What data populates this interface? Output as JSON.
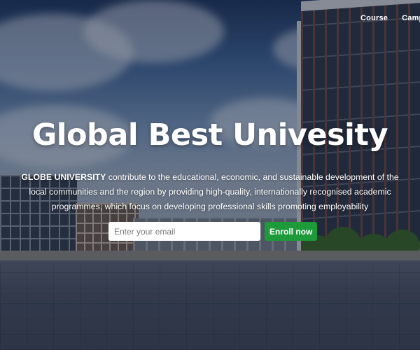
{
  "nav": {
    "items": [
      {
        "label": "Course"
      },
      {
        "label": "Campus"
      }
    ]
  },
  "hero": {
    "title": "Global Best Univesity",
    "brand": "GLOBE UNIVERSITY",
    "description": " contribute to the educational, economic, and sustainable development of the local communities and the region by providing high-quality, internationally recognised academic programmes, which focus on developing professional skills promoting employability"
  },
  "enroll": {
    "email_placeholder": "Enter your email",
    "button_label": "Enroll now"
  },
  "colors": {
    "accent": "#1d9a3a",
    "text": "#ffffff"
  }
}
